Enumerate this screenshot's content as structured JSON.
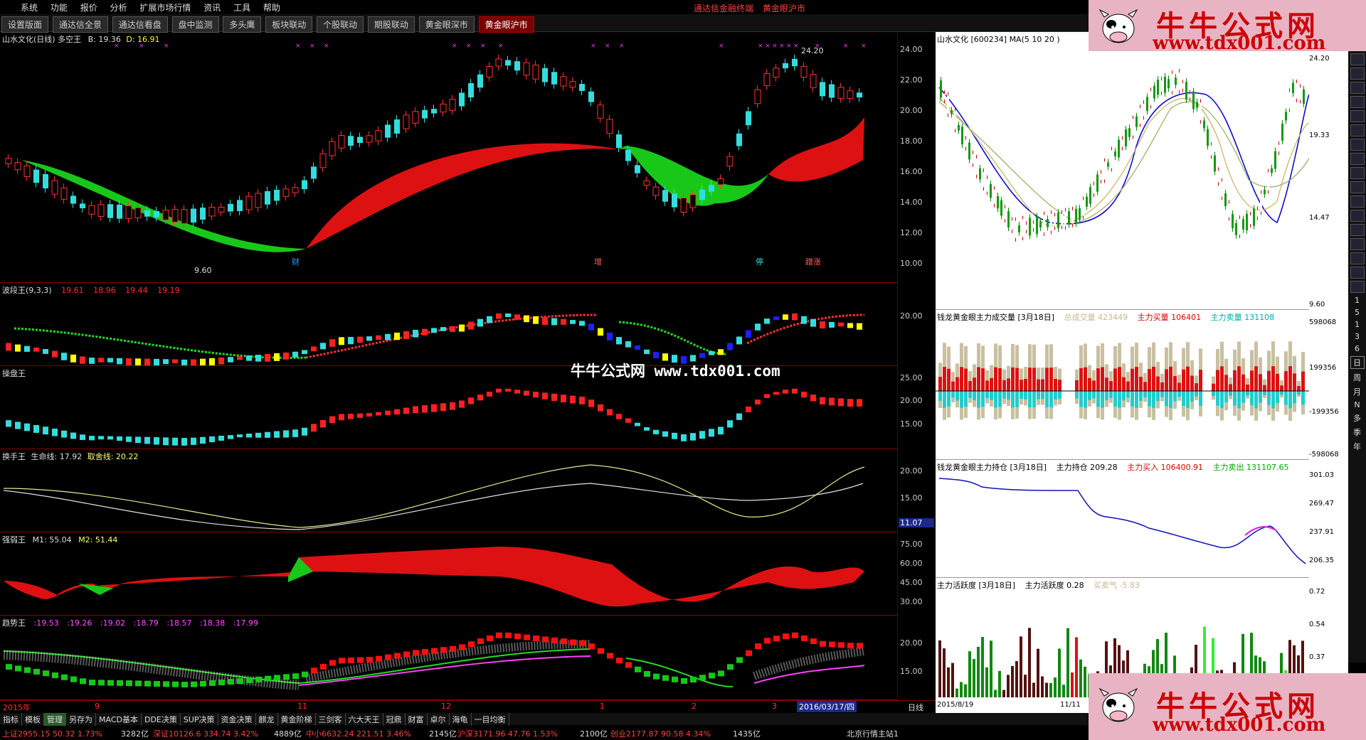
{
  "menu": {
    "items": [
      "系统",
      "功能",
      "报价",
      "分析",
      "扩展市场行情",
      "资讯",
      "工具",
      "帮助"
    ],
    "brand_left": "通达信金融终端",
    "brand_right": "黄金眼沪市"
  },
  "tabs": [
    "设置版面",
    "通达信全景",
    "通达信看盘",
    "盘中监测",
    "多头鹰",
    "板块联动",
    "个股联动",
    "期股联动",
    "黄金眼深市",
    "黄金眼沪市"
  ],
  "watermark": "牛牛公式网 www.tdx001.com",
  "ads": {
    "line1": "牛牛公式网",
    "line2": "www.tdx001.com"
  },
  "main_chart": {
    "title": "山水文化(日线) 多空王",
    "b_label": "B: 19.36",
    "d_label": "D: 16.91",
    "high_label": "24.20",
    "low_label": "9.60",
    "axis": [
      "24.00",
      "22.00",
      "20.00",
      "18.00",
      "16.00",
      "14.00",
      "12.00",
      "10.00"
    ],
    "markers": [
      "财",
      "增",
      "停",
      "蹭涨"
    ],
    "colors": {
      "up": "#ff2020",
      "down": "#33dddd",
      "bull_fill": "#dd1111",
      "bear_fill": "#11cc11"
    }
  },
  "bodong": {
    "title": "波段王(9,3,3)",
    "v1": "19.61",
    "v2": "18.96",
    "v3": "19.44",
    "v4": "19.19",
    "axis": [
      "20.00"
    ]
  },
  "caopan": {
    "title": "操盘王",
    "axis": [
      "25.00",
      "20.00",
      "15.00"
    ]
  },
  "huanshou": {
    "title": "换手王",
    "l1": "生命线: 17.92",
    "l2": "取舍线: 20.22",
    "axis": [
      "20.00",
      "15.00"
    ],
    "tag": "11.07"
  },
  "qiangruo": {
    "title": "强弱王",
    "m1": "M1: 55.04",
    "m2": "M2: 51.44",
    "axis": [
      "75.00",
      "60.00",
      "45.00",
      "30.00"
    ]
  },
  "qushi": {
    "title": "趋势王",
    "vals": [
      ":19.53",
      ":19.26",
      ":19.02",
      ":18.79",
      ":18.57",
      ":18.38",
      ":17.99"
    ],
    "axis": [
      "20.00",
      "15.00"
    ]
  },
  "xaxis": {
    "labels": [
      "2015年",
      "9",
      "11",
      "12",
      "1",
      "2",
      "3"
    ],
    "date": "2016/03/17/四",
    "period": "日线"
  },
  "bottom_tabs": [
    "指标",
    "模板",
    "管理",
    "另存为",
    "MACD基本",
    "DDE决策",
    "SUP决策",
    "资金决策",
    "麒龙",
    "黄金阶梯",
    "三剑客",
    "六大天王",
    "冠鼎",
    "财富",
    "卓尔",
    "海龟",
    "一目均衡"
  ],
  "right": {
    "k_title": "山水文化 [600234] MA(5 10 20 )",
    "k_axis": [
      "24.20",
      "19.33",
      "14.47",
      "9.60"
    ],
    "vol_title": "钱龙黄金眼主力成交量 [3月18日]",
    "vol_total": "总成交量 423449",
    "vol_buy": "主力买量 106401",
    "vol_sell": "主力卖量 131108",
    "vol_axis": [
      "598068",
      "199356",
      "-199356",
      "-598068"
    ],
    "hold_title": "钱龙黄金眼主力持仓 [3月18日]",
    "hold_val": "主力持仓 209.28",
    "hold_buy": "主力买入 106400.91",
    "hold_sell": "主力卖出 131107.65",
    "hold_axis": [
      "301.03",
      "269.47",
      "237.91",
      "206.35"
    ],
    "act_title": "主力活跃度 [3月18日]",
    "act_val": "主力活跃度 0.28",
    "act_mood": "买卖气 -5.83",
    "act_axis": [
      "0.72",
      "0.54",
      "0.37"
    ],
    "date1": "2015/8/19",
    "date2": "11/11",
    "tool_labels": [
      "1",
      "5",
      "1",
      "3",
      "6",
      "日",
      "周",
      "月",
      "N",
      "多",
      "季",
      "年"
    ]
  },
  "status": {
    "sh": "上证2955.15  50.32  1.73%",
    "sh_amt": "3282亿",
    "sz": "深证10126.6  334.74  3.42%",
    "sz_amt": "4889亿",
    "zx": "中小6632.24  221.51  3.46%",
    "zx_amt": "2145亿",
    "hs": "沪深3171.96  47.76  1.53%",
    "hs_amt": "2100亿",
    "cy": "创业2177.87  90.58  4.34%",
    "cy_amt": "1435亿",
    "server": "北京行情主站1"
  }
}
